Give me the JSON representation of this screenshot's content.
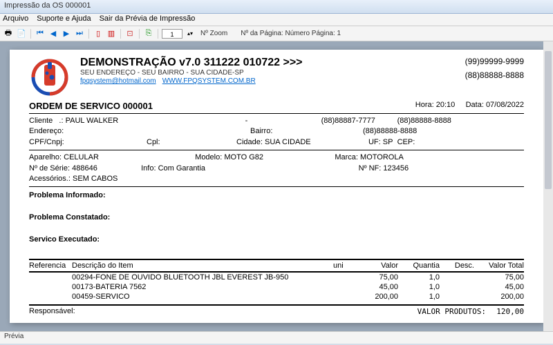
{
  "window": {
    "title": "Impressão da OS 000001"
  },
  "menu": {
    "arquivo": "Arquivo",
    "suporte": "Suporte e Ajuda",
    "sair": "Sair da Prévia de Impressão"
  },
  "toolbar": {
    "zoom_value": "1",
    "zoom_label": "Nº Zoom",
    "page_label": "Nº da Página: Número Página: 1"
  },
  "company": {
    "title": "DEMONSTRAÇÃO v7.0 311222 010722 >>>",
    "address": "SEU ENDEREÇO - SEU BAIRRO - SUA CIDADE-SP",
    "email": "fpqsystem@hotmail.com",
    "site": "WWW.FPQSYSTEM.COM.BR",
    "phone1": "(99)99999-9999",
    "phone2": "(88)88888-8888"
  },
  "os": {
    "title": "ORDEM DE SERVICO 000001",
    "hora_label": "Hora:",
    "hora": "20:10",
    "data_label": "Data:",
    "data": "07/08/2022"
  },
  "cli": {
    "cliente_l": "Cliente   .:",
    "cliente": "PAUL WALKER",
    "dash": "-",
    "tel1": "(88)88887-7777",
    "tel2": "(88)88888-8888",
    "end_l": "Endereço:",
    "bairro_l": "Bairro:",
    "tel3": "(88)88888-8888",
    "cpf_l": "CPF/Cnpj:",
    "cpl_l": "Cpl:",
    "cidade_l": "Cidade:",
    "cidade": "SUA CIDADE",
    "uf_l": "UF:",
    "uf": "SP",
    "cep_l": "CEP:"
  },
  "dev": {
    "ap_l": "Aparelho:",
    "ap": "CELULAR",
    "mod_l": "Modelo:",
    "mod": "MOTO G82",
    "marca_l": "Marca:",
    "marca": "MOTOROLA",
    "serie_l": "Nº de Série:",
    "serie": "488646",
    "info_l": "Info:",
    "info": "Com Garantia",
    "nf_l": "Nº NF:",
    "nf": "123456",
    "acc_l": "Acessórios.:",
    "acc": "SEM CABOS"
  },
  "sect": {
    "p1": "Problema Informado:",
    "p2": "Problema Constatado:",
    "p3": "Servico Executado:"
  },
  "tbl": {
    "h_ref": "Referencia",
    "h_desc": "Descrição do Item",
    "h_uni": "uni",
    "h_val": "Valor",
    "h_qty": "Quantia",
    "h_dsc": "Desc.",
    "h_tot": "Valor Total",
    "rows": [
      {
        "ref": "",
        "desc": "00294-FONE DE OUVIDO BLUETOOTH JBL EVEREST JB-950",
        "uni": "",
        "val": "75,00",
        "qty": "1,0",
        "dsc": "",
        "tot": "75,00"
      },
      {
        "ref": "",
        "desc": "00173-BATERIA 7562",
        "uni": "",
        "val": "45,00",
        "qty": "1,0",
        "dsc": "",
        "tot": "45,00"
      },
      {
        "ref": "",
        "desc": "00459-SERVICO",
        "uni": "",
        "val": "200,00",
        "qty": "1,0",
        "dsc": "",
        "tot": "200,00"
      }
    ]
  },
  "footer": {
    "resp": "Responsável:",
    "vp_l": "VALOR PRODUTOS:",
    "vp": "120,00"
  },
  "status": {
    "text": "Prévia"
  }
}
